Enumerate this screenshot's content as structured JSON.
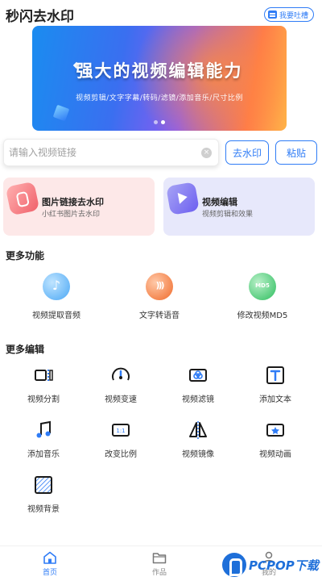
{
  "header": {
    "title": "秒闪去水印",
    "feedback_label": "我要吐槽"
  },
  "banner": {
    "title": "强大的视频编辑能力",
    "subtitle": "视频剪辑/文字字幕/转码/滤镜/添加音乐/尺寸比例",
    "slides": 2,
    "active_slide": 2
  },
  "search": {
    "placeholder": "请输入视频链接",
    "value": ""
  },
  "buttons": {
    "remove_watermark": "去水印",
    "paste": "粘贴"
  },
  "cards": [
    {
      "title": "图片链接去水印",
      "subtitle": "小红书图片去水印"
    },
    {
      "title": "视频编辑",
      "subtitle": "视频剪辑和效果"
    }
  ],
  "more_features": {
    "title": "更多功能",
    "items": [
      {
        "label": "视频提取音频",
        "icon": "music-note-icon"
      },
      {
        "label": "文字转语音",
        "icon": "sound-wave-icon"
      },
      {
        "label": "修改视频MD5",
        "icon": "md5-icon"
      }
    ]
  },
  "more_edit": {
    "title": "更多编辑",
    "items": [
      {
        "label": "视频分割",
        "icon": "split-icon"
      },
      {
        "label": "视频变速",
        "icon": "speedometer-icon"
      },
      {
        "label": "视频滤镜",
        "icon": "filter-icon"
      },
      {
        "label": "添加文本",
        "icon": "text-icon"
      },
      {
        "label": "添加音乐",
        "icon": "music-icon"
      },
      {
        "label": "改变比例",
        "icon": "ratio-icon"
      },
      {
        "label": "视频镜像",
        "icon": "mirror-icon"
      },
      {
        "label": "视频动画",
        "icon": "animation-icon"
      },
      {
        "label": "视频背景",
        "icon": "background-icon"
      }
    ]
  },
  "bottom_nav": [
    {
      "label": "首页",
      "icon": "home-icon",
      "active": true
    },
    {
      "label": "作品",
      "icon": "folder-icon",
      "active": false
    },
    {
      "label": "我的",
      "icon": "user-icon",
      "active": false
    }
  ],
  "watermark": {
    "text": "PCPOP下载"
  },
  "colors": {
    "accent": "#2f7cf6",
    "card_pink": "#fde8e8",
    "card_lavender": "#e7e8fb"
  }
}
